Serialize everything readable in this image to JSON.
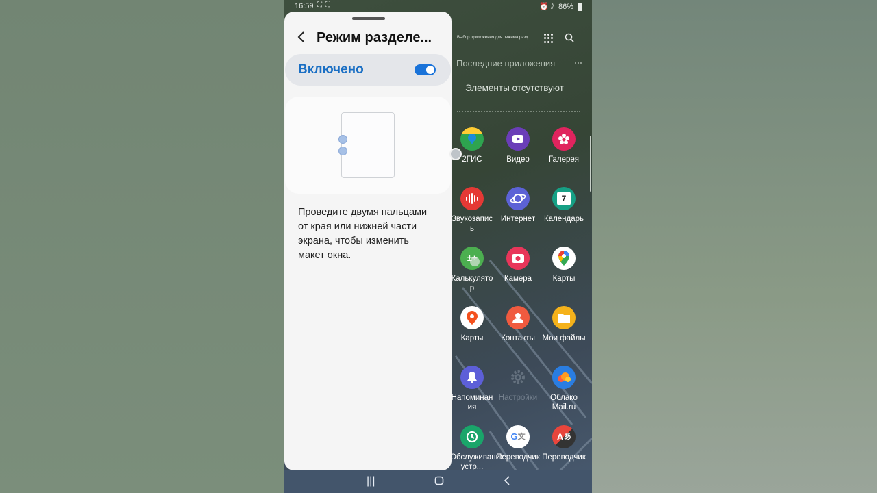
{
  "status_bar": {
    "time": "16:59",
    "left_icons": "⛶ ⛶",
    "right_icons": "⏰ ⫽",
    "battery": "86%"
  },
  "settings_panel": {
    "title": "Режим разделе...",
    "toggle_label": "Включено",
    "toggle_on": true,
    "help_text": "Проведите двумя пальцами от края или нижней части экрана, чтобы изменить макет окна."
  },
  "drawer": {
    "header": "Выбор приложения для режима разд...",
    "recent_title": "Последние приложения",
    "recent_empty": "Элементы отсутствуют",
    "apps": [
      {
        "label": "2ГИС",
        "icon": "2gis-icon",
        "color": "#2ea44f"
      },
      {
        "label": "Видео",
        "icon": "video-icon",
        "color": "#6a3db8"
      },
      {
        "label": "Галерея",
        "icon": "gallery-icon",
        "color": "#e0245e"
      },
      {
        "label": "Звукозапись",
        "icon": "voice-recorder-icon",
        "color": "#e53935"
      },
      {
        "label": "Интернет",
        "icon": "internet-icon",
        "color": "#5c62d6"
      },
      {
        "label": "Календарь",
        "icon": "calendar-icon",
        "color": "#16a085"
      },
      {
        "label": "Калькулятор",
        "icon": "calculator-icon",
        "color": "#4caf50"
      },
      {
        "label": "Камера",
        "icon": "camera-icon",
        "color": "#e8365a"
      },
      {
        "label": "Карты",
        "icon": "google-maps-icon",
        "color": "#ffffff"
      },
      {
        "label": "Карты",
        "icon": "maps-pin-icon",
        "color": "#ffffff"
      },
      {
        "label": "Контакты",
        "icon": "contacts-icon",
        "color": "#f05a3f"
      },
      {
        "label": "Мои файлы",
        "icon": "my-files-icon",
        "color": "#f5b21b"
      },
      {
        "label": "Напоминания",
        "icon": "reminder-icon",
        "color": "#5d5fd8"
      },
      {
        "label": "Настройки",
        "icon": "settings-icon",
        "color": "#6d7a86"
      },
      {
        "label": "Облако Mail.ru",
        "icon": "cloud-icon",
        "color": "#2a7de1"
      },
      {
        "label": "Обслуживание устр...",
        "icon": "device-care-icon",
        "color": "#1aa56a"
      },
      {
        "label": "Переводчик",
        "icon": "google-translate-icon",
        "color": "#ffffff"
      },
      {
        "label": "Переводчик",
        "icon": "translator-icon",
        "color": "#e8453c"
      }
    ]
  },
  "colors": {
    "accent": "#1a73d9",
    "panel_bg": "#f5f5f5"
  }
}
